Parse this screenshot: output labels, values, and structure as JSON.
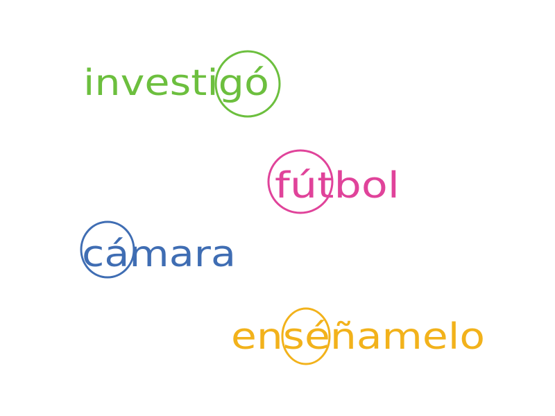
{
  "words": [
    {
      "id": "investigo",
      "pre": "investi",
      "stressed": "gó",
      "post": "",
      "color": "#6cbf3e"
    },
    {
      "id": "futbol",
      "pre": "",
      "stressed": "fút",
      "post": "bol",
      "color": "#e0439a"
    },
    {
      "id": "camara",
      "pre": "",
      "stressed": "cá",
      "post": "mara",
      "color": "#3f6db3"
    },
    {
      "id": "ensenamelo",
      "pre": "en",
      "stressed": "sé",
      "post": "ñamelo",
      "color": "#f2b21b"
    }
  ]
}
